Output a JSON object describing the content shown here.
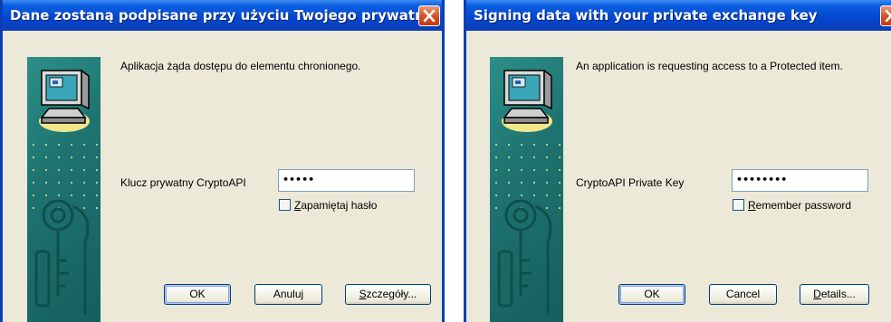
{
  "dialogs": {
    "pl": {
      "title": "Dane zostaną podpisane przy użyciu Twojego prywatn...",
      "message": "Aplikacja żąda dostępu do elementu chronionego.",
      "key_label": "Klucz prywatny CryptoAPI",
      "password_value": "•••••",
      "remember_first": "Z",
      "remember_rest": "apamiętaj hasło",
      "ok_label": "OK",
      "cancel_label": "Anuluj",
      "details_first": "S",
      "details_rest": "zczegóły..."
    },
    "en": {
      "title": "Signing data with your private exchange key",
      "message": "An application is requesting access to a Protected item.",
      "key_label": "CryptoAPI Private Key",
      "password_value": "••••••••",
      "remember_first": "R",
      "remember_rest": "emember password",
      "ok_label": "OK",
      "cancel_label": "Cancel",
      "details_first": "D",
      "details_rest": "etails..."
    }
  },
  "icons": {
    "close": "close-icon",
    "computer": "computer-icon",
    "keys": "keys-icon"
  },
  "colors": {
    "titlebar": "#0546cf",
    "dialog_bg": "#ece9d8",
    "sidebar": "#1e7370",
    "close_button": "#d5532b"
  }
}
